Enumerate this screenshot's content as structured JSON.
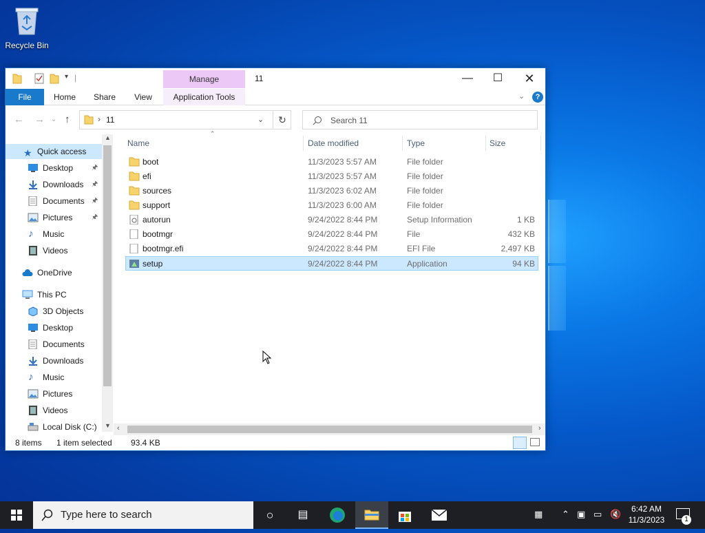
{
  "desktop": {
    "recycle_bin_label": "Recycle Bin"
  },
  "window": {
    "title": "11",
    "contextual_group": "Manage",
    "ribbon_tabs": [
      "File",
      "Home",
      "Share",
      "View",
      "Application Tools"
    ],
    "address_path": "11",
    "search_placeholder": "Search 11"
  },
  "nav_pane": {
    "items": [
      {
        "label": "Quick access",
        "icon": "star-icon"
      },
      {
        "label": "Desktop",
        "icon": "desktop-icon"
      },
      {
        "label": "Downloads",
        "icon": "downloads-icon"
      },
      {
        "label": "Documents",
        "icon": "documents-icon"
      },
      {
        "label": "Pictures",
        "icon": "pictures-icon"
      },
      {
        "label": "Music",
        "icon": "music-icon"
      },
      {
        "label": "Videos",
        "icon": "videos-icon"
      },
      {
        "label": "OneDrive",
        "icon": "cloud-icon"
      },
      {
        "label": "This PC",
        "icon": "computer-icon"
      },
      {
        "label": "3D Objects",
        "icon": "cube-icon"
      },
      {
        "label": "Desktop",
        "icon": "desktop-icon"
      },
      {
        "label": "Documents",
        "icon": "documents-icon"
      },
      {
        "label": "Downloads",
        "icon": "downloads-icon"
      },
      {
        "label": "Music",
        "icon": "music-icon"
      },
      {
        "label": "Pictures",
        "icon": "pictures-icon"
      },
      {
        "label": "Videos",
        "icon": "videos-icon"
      },
      {
        "label": "Local Disk (C:)",
        "icon": "drive-icon"
      }
    ]
  },
  "columns": [
    "Name",
    "Date modified",
    "Type",
    "Size"
  ],
  "files": [
    {
      "name": "boot",
      "date": "11/3/2023 5:57 AM",
      "type": "File folder",
      "size": ""
    },
    {
      "name": "efi",
      "date": "11/3/2023 5:57 AM",
      "type": "File folder",
      "size": ""
    },
    {
      "name": "sources",
      "date": "11/3/2023 6:02 AM",
      "type": "File folder",
      "size": ""
    },
    {
      "name": "support",
      "date": "11/3/2023 6:00 AM",
      "type": "File folder",
      "size": ""
    },
    {
      "name": "autorun",
      "date": "9/24/2022 8:44 PM",
      "type": "Setup Information",
      "size": "1 KB"
    },
    {
      "name": "bootmgr",
      "date": "9/24/2022 8:44 PM",
      "type": "File",
      "size": "432 KB"
    },
    {
      "name": "bootmgr.efi",
      "date": "9/24/2022 8:44 PM",
      "type": "EFI File",
      "size": "2,497 KB"
    },
    {
      "name": "setup",
      "date": "9/24/2022 8:44 PM",
      "type": "Application",
      "size": "94 KB"
    }
  ],
  "status": {
    "count": "8 items",
    "selection": "1 item selected",
    "selection_size": "93.4 KB"
  },
  "taskbar": {
    "search_placeholder": "Type here to search",
    "time": "6:42 AM",
    "date": "11/3/2023",
    "notifications": "1"
  },
  "colors": {
    "accent": "#1979ca",
    "selection": "#cce8ff",
    "manage_tab": "#ecc8f7"
  }
}
